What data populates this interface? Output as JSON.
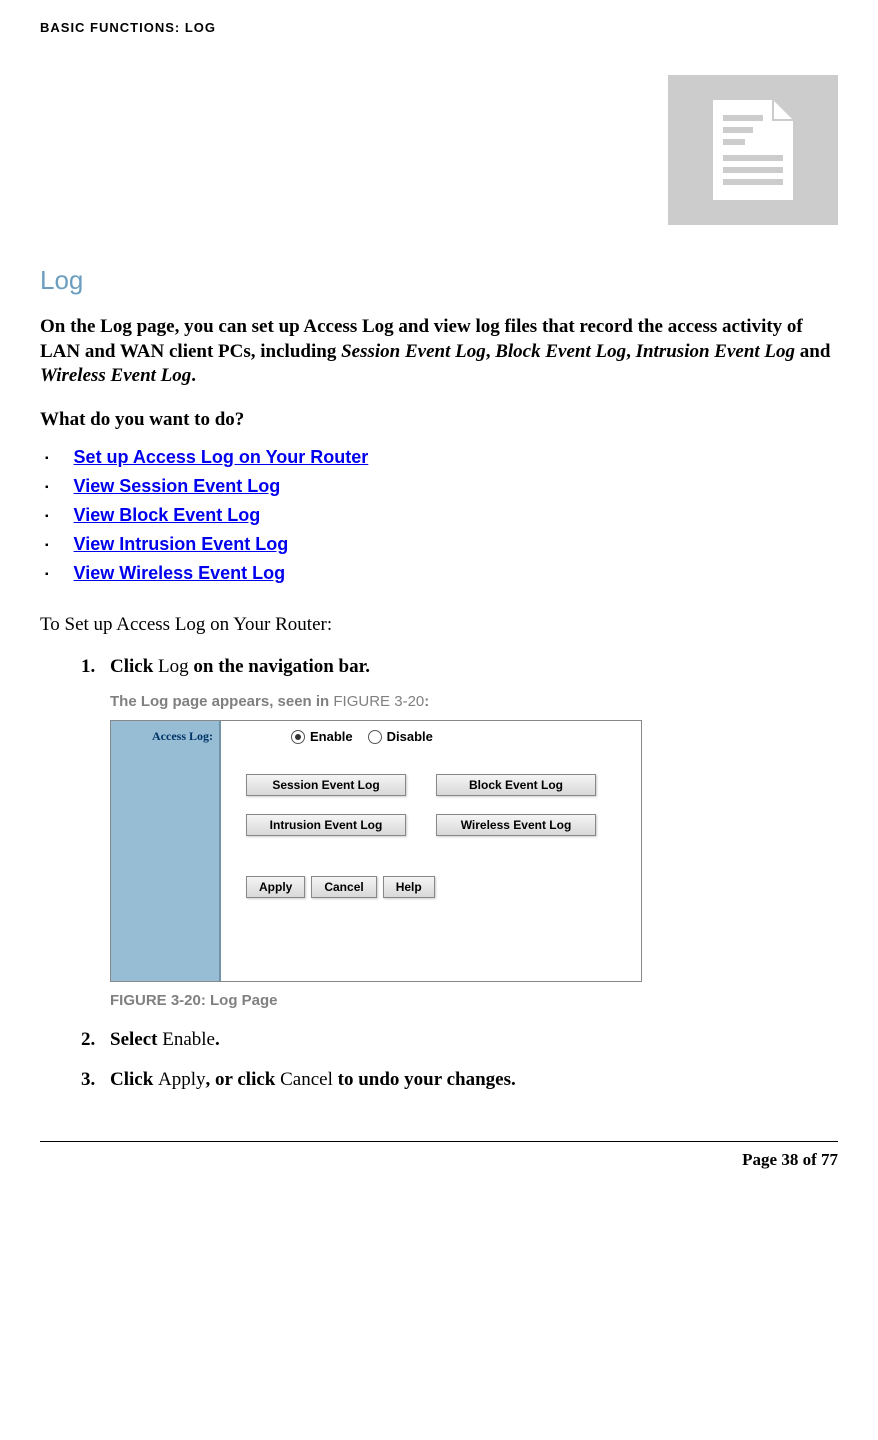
{
  "header": "BASIC FUNCTIONS: LOG",
  "section_title": "Log",
  "intro": {
    "part1": "On the Log page, you can set up Access Log and view log files that record the access activity of LAN and WAN client PCs, including ",
    "sess": "Session Event Log",
    "sep1": ", ",
    "block": "Block Event Log",
    "sep2": ", ",
    "intr": "Intrusion Event Log",
    "and": " and ",
    "wire": "Wireless Event Log",
    "end": "."
  },
  "subheading": "What do you want to do?",
  "links": {
    "l1": "Set up Access Log on Your Router",
    "l2": "View Session Event Log",
    "l3": "View Block Event Log",
    "l4": "View Intrusion Event Log",
    "l5": "View Wireless Event Log"
  },
  "procedure_title": "To Set up Access Log on Your Router:",
  "steps": {
    "s1_a": "Click ",
    "s1_b": "Log",
    "s1_c": " on the navigation bar.",
    "s2_a": "Select ",
    "s2_b": "Enable",
    "s2_c": ".",
    "s3_a": "Click ",
    "s3_b": "Apply",
    "s3_c": ", or click ",
    "s3_d": "Cancel",
    "s3_e": " to undo your changes."
  },
  "figure_intro_a": "The Log page appears, seen in ",
  "figure_intro_b": "FIGURE 3-20",
  "figure_intro_c": ":",
  "figure": {
    "access_label": "Access Log:",
    "enable": "Enable",
    "disable": "Disable",
    "btn1": "Session Event Log",
    "btn2": "Block Event Log",
    "btn3": "Intrusion Event Log",
    "btn4": "Wireless Event Log",
    "apply": "Apply",
    "cancel": "Cancel",
    "help": "Help"
  },
  "figure_caption": "FIGURE 3-20: Log Page",
  "footer": "Page 38 of 77"
}
